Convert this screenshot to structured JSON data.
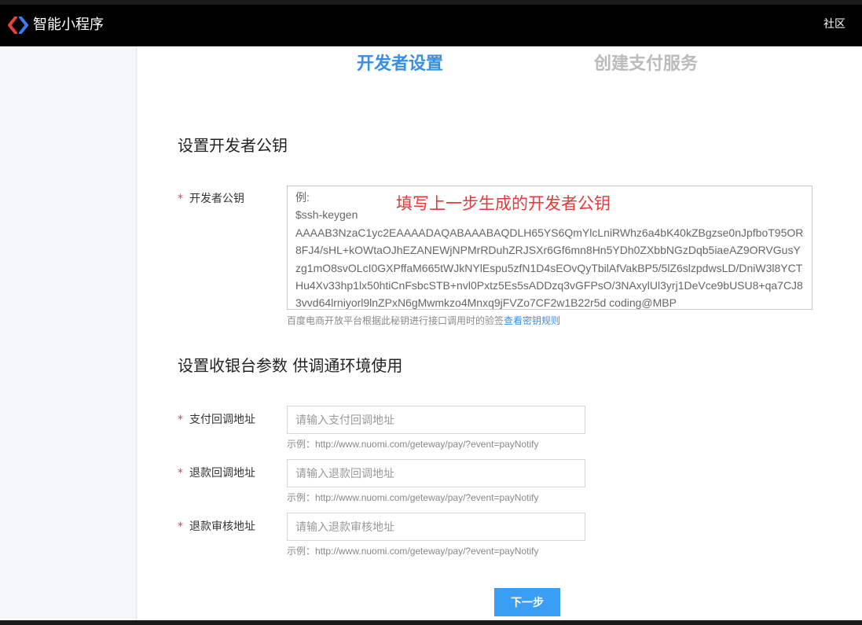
{
  "header": {
    "brand": "智能小程序",
    "community": "社区",
    "logo_icon": "swan-logo-icon",
    "logo_colors": [
      "#e8403c",
      "#3b7cf0"
    ]
  },
  "steps": [
    {
      "label": "开发者设置",
      "active": true
    },
    {
      "label": "创建支付服务",
      "active": false
    }
  ],
  "developer_key_section": {
    "title": "设置开发者公钥",
    "field": {
      "label": "开发者公钥",
      "required_mark": "*",
      "placeholder_lines": [
        "例:",
        "$ssh-keygen",
        "AAAAB3NzaC1yc2EAAAADAQABAAABAQDLH65YS6QmYlcLniRWhz6a4bK40kZBgzse0nJpfboT95OR8FJ4/sHL+kOWtaOJhEZANEWjNPMrRDuhZRJSXr6Gf6mn8Hn5YDh0ZXbbNGzDqb5iaeAZ9ORVGusYzg1mO8svOLcI0GXPffaM665tWJkNYlEspu5zfN1D4sEOvQyTbilAfVakBP5/5lZ6slzpdwsLD/DniW3l8YCTHu4Xv33hp1lx50htiCnFsbcSTB+nvl0Pxtz5Es5sADDzq3vGFPsO/3NAxylUl3yrj1DeVce9bUSU8+qa7CJ83vvd64lrniyorl9lnZPxN6gMwmkzo4Mnxq9jFVZo7CF2w1B22r5d coding@MBP"
      ],
      "annotation": "填写上一步生成的开发者公钥"
    },
    "help_text": "百度电商开放平台根据此秘钥进行接口调用时的验签",
    "help_link": "查看密钥规则"
  },
  "cashier_section": {
    "title": "设置收银台参数 供调通环境使用",
    "fields": [
      {
        "label": "支付回调地址",
        "placeholder": "请输入支付回调地址",
        "example": "示例：http://www.nuomi.com/geteway/pay/?event=payNotify"
      },
      {
        "label": "退款回调地址",
        "placeholder": "请输入退款回调地址",
        "example": "示例：http://www.nuomi.com/geteway/pay/?event=payNotify"
      },
      {
        "label": "退款审核地址",
        "placeholder": "请输入退款审核地址",
        "example": "示例：http://www.nuomi.com/geteway/pay/?event=payNotify"
      }
    ],
    "required_mark": "*"
  },
  "actions": {
    "next_label": "下一步"
  },
  "colors": {
    "accent": "#3a8ee6",
    "required": "#e54545",
    "annotation": "#e23a3a"
  }
}
